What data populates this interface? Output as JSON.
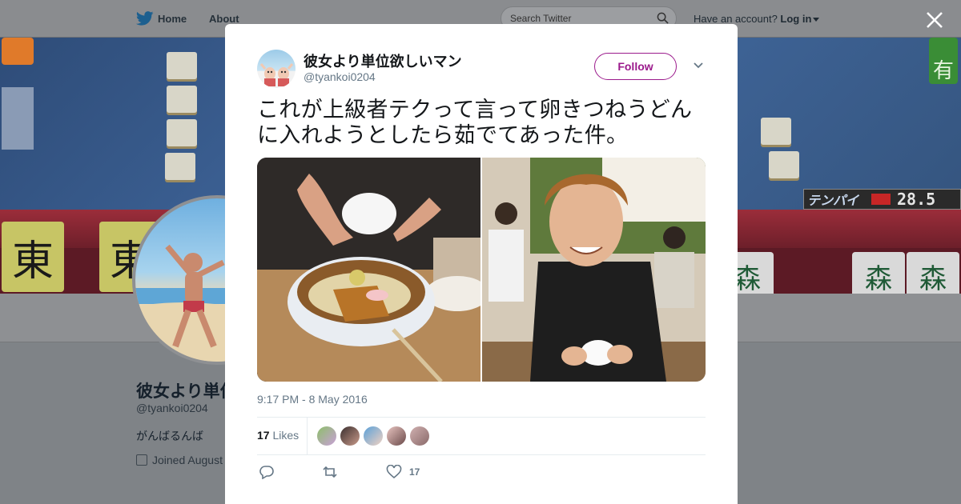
{
  "header": {
    "nav_home": "Home",
    "nav_about": "About",
    "search_placeholder": "Search Twitter",
    "have_account": "Have an account?",
    "login": "Log in"
  },
  "banner": {
    "score_label": "テンパイ",
    "score_value": "28.5",
    "big_tile": "東",
    "white_tile": "森",
    "side_tile": "有"
  },
  "profile": {
    "name": "彼女より単位欲しいマン",
    "handle": "@tyankoi0204",
    "bio": "がんばるんば",
    "joined": "Joined August"
  },
  "tweet": {
    "author_name": "彼女より単位欲しいマン",
    "author_handle": "@tyankoi0204",
    "follow_label": "Follow",
    "text": "これが上級者テクって言って卵きつねうどんに入れようとしたら茹でてあった件。",
    "timestamp": "9:17 PM - 8 May 2016",
    "likes_count": "17",
    "likes_label": "Likes",
    "like_action_count": "17"
  },
  "colors": {
    "follow_accent": "#9b1a8c",
    "muted_text": "#657786",
    "overlay_bg": "#7f8387"
  }
}
